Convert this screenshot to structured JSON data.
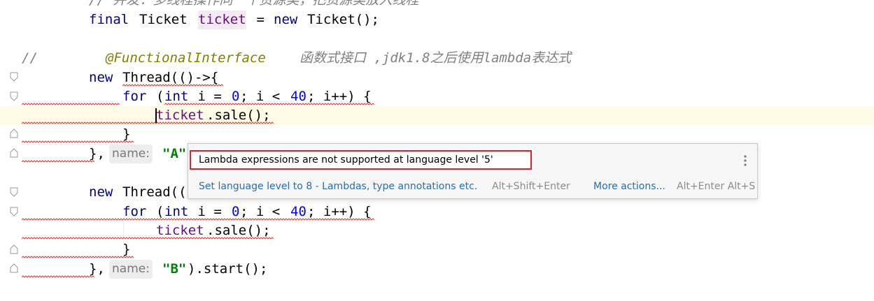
{
  "code": {
    "comment_top": "// 并发：多线程操作同一个资源类，把资源类放入线程",
    "kw_final": "final",
    "type_ticket": "Ticket",
    "var_ticket": "ticket",
    "eq": " = ",
    "kw_new": "new",
    "ctor_ticket": "Ticket();",
    "comment_slashes": "//",
    "annotation": "@FunctionalInterface",
    "annotation_note": "函数式接口 ,jdk1.8之后使用lambda表达式",
    "thread_lambda": "Thread(()->{",
    "thread_lambda_cut": "Thread((",
    "kw_for": "for",
    "for_open": "(",
    "kw_int": "int",
    "for_var": " i = ",
    "num_zero": "0",
    "for_cond": "; i < ",
    "num_forty": "40",
    "for_tail": "; i++) {",
    "sale_call": ".sale();",
    "close_brace": "}",
    "close_call": "},",
    "hint_name": "name:",
    "str_a": "\"A\"",
    "str_b": "\"B\"",
    "start_call": ").start();"
  },
  "popup": {
    "message": "Lambda expressions are not supported at language level '5'",
    "fix_action": "Set language level to 8 - Lambdas, type annotations etc.",
    "fix_shortcut": "Alt+Shift+Enter",
    "more_actions": "More actions...",
    "more_shortcut": "Alt+Enter Alt+S",
    "menu_icon": "more-vertical-icon"
  },
  "colors": {
    "keyword": "#000080",
    "number": "#0000ff",
    "string": "#008000",
    "field": "#660e7a",
    "comment": "#808080",
    "error_border": "#e0202a",
    "link": "#2470b3"
  }
}
